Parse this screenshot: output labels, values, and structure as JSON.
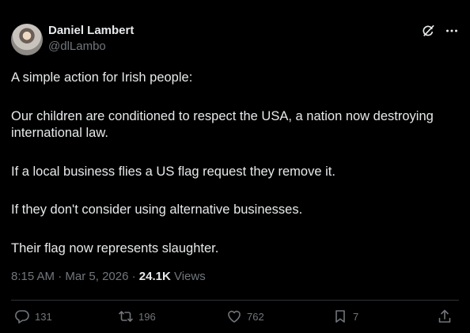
{
  "author": {
    "display_name": "Daniel Lambert",
    "handle": "@dlLambo"
  },
  "tweet": {
    "paragraphs": [
      "A simple action for Irish people:",
      "Our children are conditioned to respect the USA, a nation now destroying international law.",
      "If a local business flies a US flag request they remove it.",
      "If they don't consider using alternative businesses.",
      "Their flag now represents slaughter."
    ]
  },
  "meta": {
    "time": "8:15 AM",
    "separator": "·",
    "date": "Mar 5, 2026",
    "views_count": "24.1K",
    "views_label": "Views"
  },
  "actions": {
    "replies": "131",
    "reposts": "196",
    "likes": "762",
    "bookmarks": "7"
  },
  "colors": {
    "background": "#000000",
    "text": "#e7e9ea",
    "muted": "#71767b",
    "divider": "#2f3336"
  },
  "icons": [
    "grok-icon",
    "more-icon",
    "reply-icon",
    "repost-icon",
    "like-icon",
    "bookmark-icon",
    "share-icon"
  ]
}
